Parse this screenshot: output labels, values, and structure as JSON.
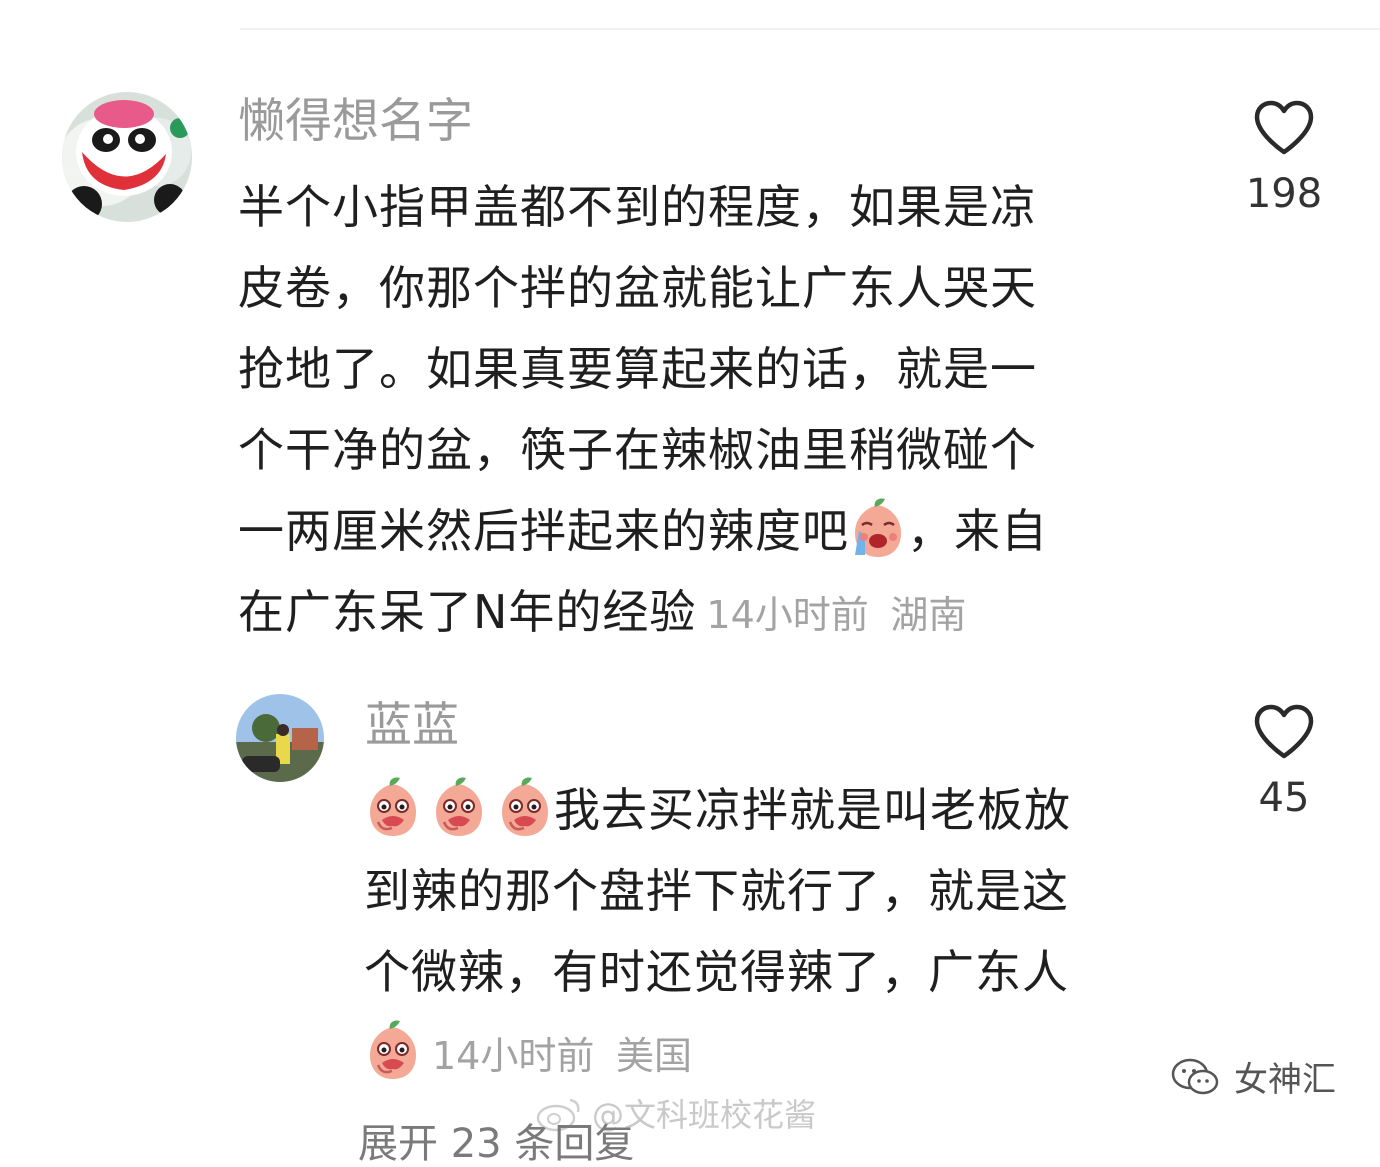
{
  "comments": [
    {
      "username": "懒得想名字",
      "lines": [
        "半个小指甲盖都不到的程度，如果是凉",
        "皮卷，你那个拌的盆就能让广东人哭天",
        "抢地了。如果真要算起来的话，就是一",
        "个干净的盆，筷子在辣椒油里稍微碰个",
        "一两厘米然后拌起来的辣度吧",
        "，来自",
        "在广东呆了N年的经验"
      ],
      "time": "14小时前",
      "location": "湖南",
      "likes": "198",
      "avatar_icon": "panda-avatar-icon",
      "inline_emoji": "crying-peach-emoji-icon"
    },
    {
      "username": "蓝蓝",
      "lines": [
        "我去买凉拌就是叫老板放",
        "到辣的那个盘拌下就行了，就是这",
        "个微辣，有时还觉得辣了，广东人"
      ],
      "time": "14小时前",
      "location": "美国",
      "likes": "45",
      "avatar_icon": "outdoor-photo-avatar-icon",
      "inline_emoji": "laughing-peach-emoji-icon"
    }
  ],
  "reply_toggle": "展开 23 条回复",
  "watermarks": {
    "brand": "女神汇",
    "weibo": "@文科班校花酱"
  },
  "colors": {
    "username": "#9a9a9a",
    "meta": "#a3a3a3",
    "text": "#1f1f1f"
  }
}
